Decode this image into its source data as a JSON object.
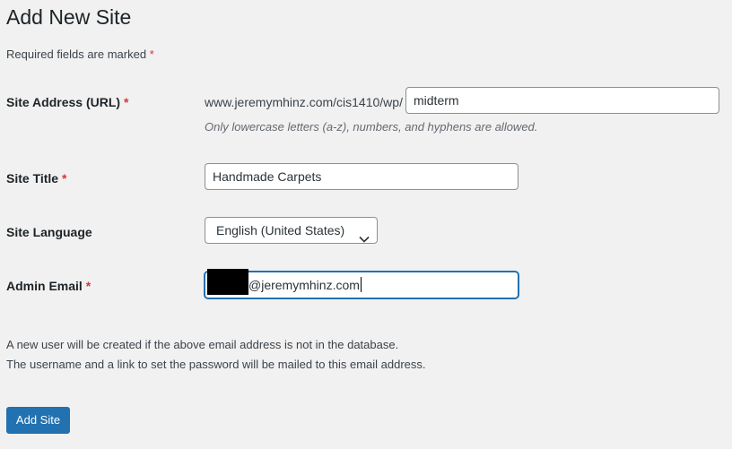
{
  "page": {
    "title": "Add New Site",
    "required_note": "Required fields are marked",
    "required_marker": "*"
  },
  "site_address": {
    "label": "Site Address (URL)",
    "prefix": "www.jeremymhinz.com/cis1410/wp/",
    "value": "midterm",
    "hint": "Only lowercase letters (a-z), numbers, and hyphens are allowed."
  },
  "site_title": {
    "label": "Site Title",
    "value": "Handmade Carpets"
  },
  "site_language": {
    "label": "Site Language",
    "selected": "English (United States)"
  },
  "admin_email": {
    "label": "Admin Email",
    "value_visible": "@jeremymhinz.com"
  },
  "description": {
    "line1": "A new user will be created if the above email address is not in the database.",
    "line2": "The username and a link to set the password will be mailed to this email address."
  },
  "submit": {
    "label": "Add Site"
  },
  "colors": {
    "primary": "#2271b1",
    "required": "#d63638",
    "background": "#f1f1f1"
  },
  "icons": {
    "select_arrow": "chevron-down-icon"
  }
}
